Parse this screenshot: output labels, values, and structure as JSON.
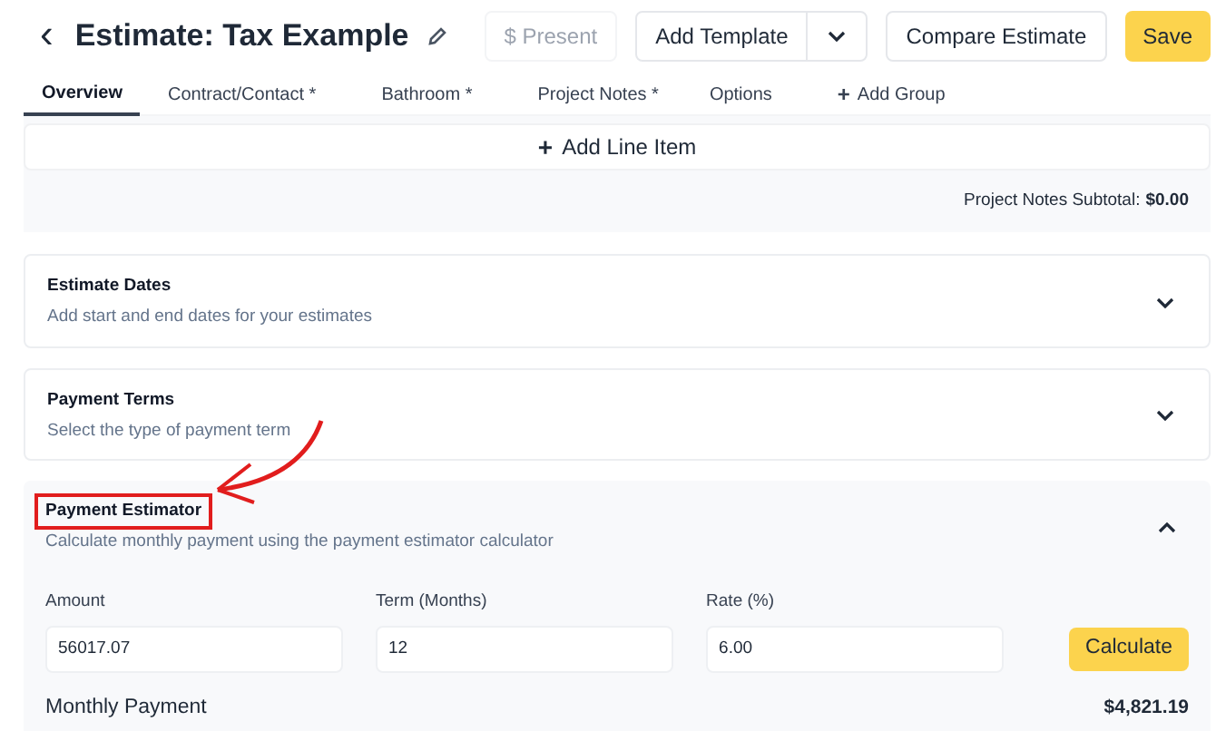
{
  "header": {
    "back": "‹",
    "title": "Estimate: Tax Example",
    "present_button": {
      "label": "$ Present",
      "disabled": true
    },
    "template_button": "Add Template",
    "compare_button": "Compare Estimate",
    "save_button": "Save"
  },
  "tabs": [
    {
      "label": "Overview",
      "selected": true
    },
    {
      "label": "Contract/Contact *",
      "selected": false
    },
    {
      "label": "Bathroom *",
      "selected": false
    },
    {
      "label": "Project Notes *",
      "selected": false
    },
    {
      "label": "Options",
      "selected": false
    },
    {
      "label": "Add Group",
      "selected": false,
      "kind": "add",
      "icon": "+"
    }
  ],
  "add_line_item": {
    "icon": "+",
    "label": "Add Line Item"
  },
  "subtotal": {
    "label": "Project Notes Subtotal:",
    "value": "$0.00"
  },
  "sections": [
    {
      "title": "Estimate Dates",
      "description": "Add start and end dates for your estimates",
      "expanded": false,
      "highlighted": false
    },
    {
      "title": "Payment Terms",
      "description": "Select the type of payment term",
      "expanded": false,
      "highlighted": false
    },
    {
      "title": "Payment Estimator",
      "description": "Calculate monthly payment using the payment estimator calculator",
      "expanded": true,
      "highlighted": true,
      "fields": [
        {
          "label": "Amount",
          "value": "56017.07"
        },
        {
          "label": "Term (Months)",
          "value": "12"
        },
        {
          "label": "Rate (%)",
          "value": "6.00"
        }
      ],
      "calculate_button": "Calculate",
      "result": {
        "label": "Monthly Payment",
        "value": "$4,821.19"
      }
    }
  ]
}
